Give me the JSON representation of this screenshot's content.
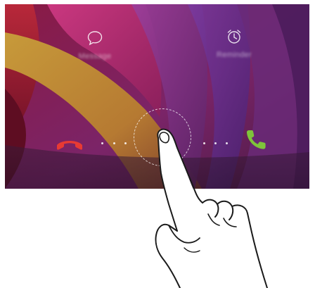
{
  "screen": {
    "actions": [
      {
        "icon": "message-icon",
        "label": "Message"
      },
      {
        "icon": "alarm-clock-icon",
        "label": "Reminder"
      }
    ],
    "decline_icon": "phone-decline-icon",
    "answer_icon": "phone-answer-icon",
    "colors": {
      "decline": "#e83a33",
      "answer": "#7ec43a"
    }
  },
  "illustration": {
    "gesture": "hand-pointing-finger"
  }
}
